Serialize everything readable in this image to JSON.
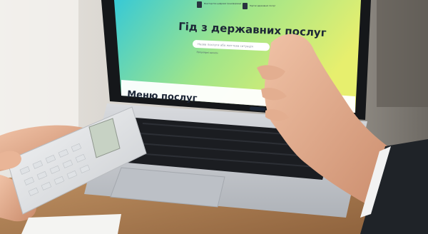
{
  "screen": {
    "title": "Гід з державних послуг",
    "section_heading": "Меню послуг",
    "search_placeholder": "Назва послуги або життєва ситуація",
    "search_hint": "Популярні запити",
    "logos": [
      {
        "text": "Міністерство цифрової трансформації",
        "icon": "trident-icon"
      },
      {
        "text": "Портал державних послуг",
        "icon": "trident-icon"
      }
    ]
  },
  "colors": {
    "screen_gradient_start": "#37c9d6",
    "screen_gradient_mid": "#9fe58a",
    "screen_gradient_end": "#e7ef6e",
    "laptop_body": "#c9ccd1",
    "keyboard": "#1b1d21",
    "calculator": "#eceef0",
    "sleeve": "#1f2328"
  }
}
